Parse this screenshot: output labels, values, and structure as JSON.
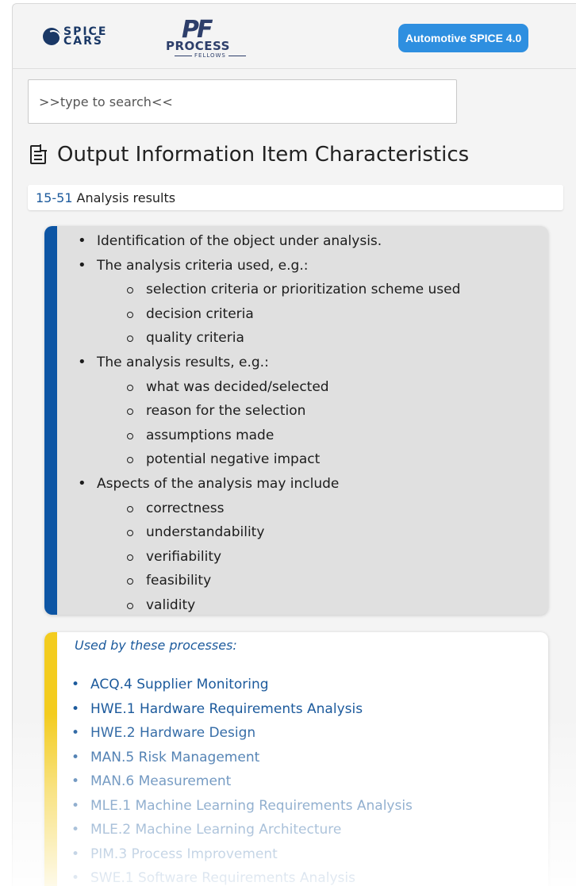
{
  "header": {
    "spice_logo": [
      "SPICE",
      "CARS"
    ],
    "pf_logo": {
      "mark": "PF",
      "name": "PROCESS",
      "sub": "FELLOWS"
    },
    "version_badge": "Automotive SPICE 4.0"
  },
  "search": {
    "placeholder": ">>type to search<<"
  },
  "page": {
    "title": "Output Information Item Characteristics",
    "title_icon": "document-icon"
  },
  "item": {
    "id": "15-51",
    "name": "Analysis results"
  },
  "characteristics": [
    {
      "level": 1,
      "text": "Identification of the object under analysis."
    },
    {
      "level": 1,
      "text": "The analysis criteria used, e.g.:"
    },
    {
      "level": 2,
      "text": "selection criteria or prioritization scheme used"
    },
    {
      "level": 2,
      "text": "decision criteria"
    },
    {
      "level": 2,
      "text": "quality criteria"
    },
    {
      "level": 1,
      "text": "The analysis results, e.g.:"
    },
    {
      "level": 2,
      "text": "what was decided/selected"
    },
    {
      "level": 2,
      "text": "reason for the selection"
    },
    {
      "level": 2,
      "text": "assumptions made"
    },
    {
      "level": 2,
      "text": "potential negative impact"
    },
    {
      "level": 1,
      "text": "Aspects of the analysis may include"
    },
    {
      "level": 2,
      "text": "correctness"
    },
    {
      "level": 2,
      "text": "understandability"
    },
    {
      "level": 2,
      "text": "verifiability"
    },
    {
      "level": 2,
      "text": "feasibility"
    },
    {
      "level": 2,
      "text": "validity"
    }
  ],
  "used_by": {
    "caption": "Used by these processes:",
    "processes": [
      "ACQ.4 Supplier Monitoring",
      "HWE.1 Hardware Requirements Analysis",
      "HWE.2 Hardware Design",
      "MAN.5 Risk Management",
      "MAN.6 Measurement",
      "MLE.1 Machine Learning Requirements Analysis",
      "MLE.2 Machine Learning Architecture",
      "PIM.3 Process Improvement",
      "SWE.1 Software Requirements Analysis"
    ]
  },
  "colors": {
    "accent_blue": "#0d55a4",
    "accent_yellow": "#f3cc1f",
    "link": "#1c5a9c",
    "badge": "#2e8fe0"
  }
}
